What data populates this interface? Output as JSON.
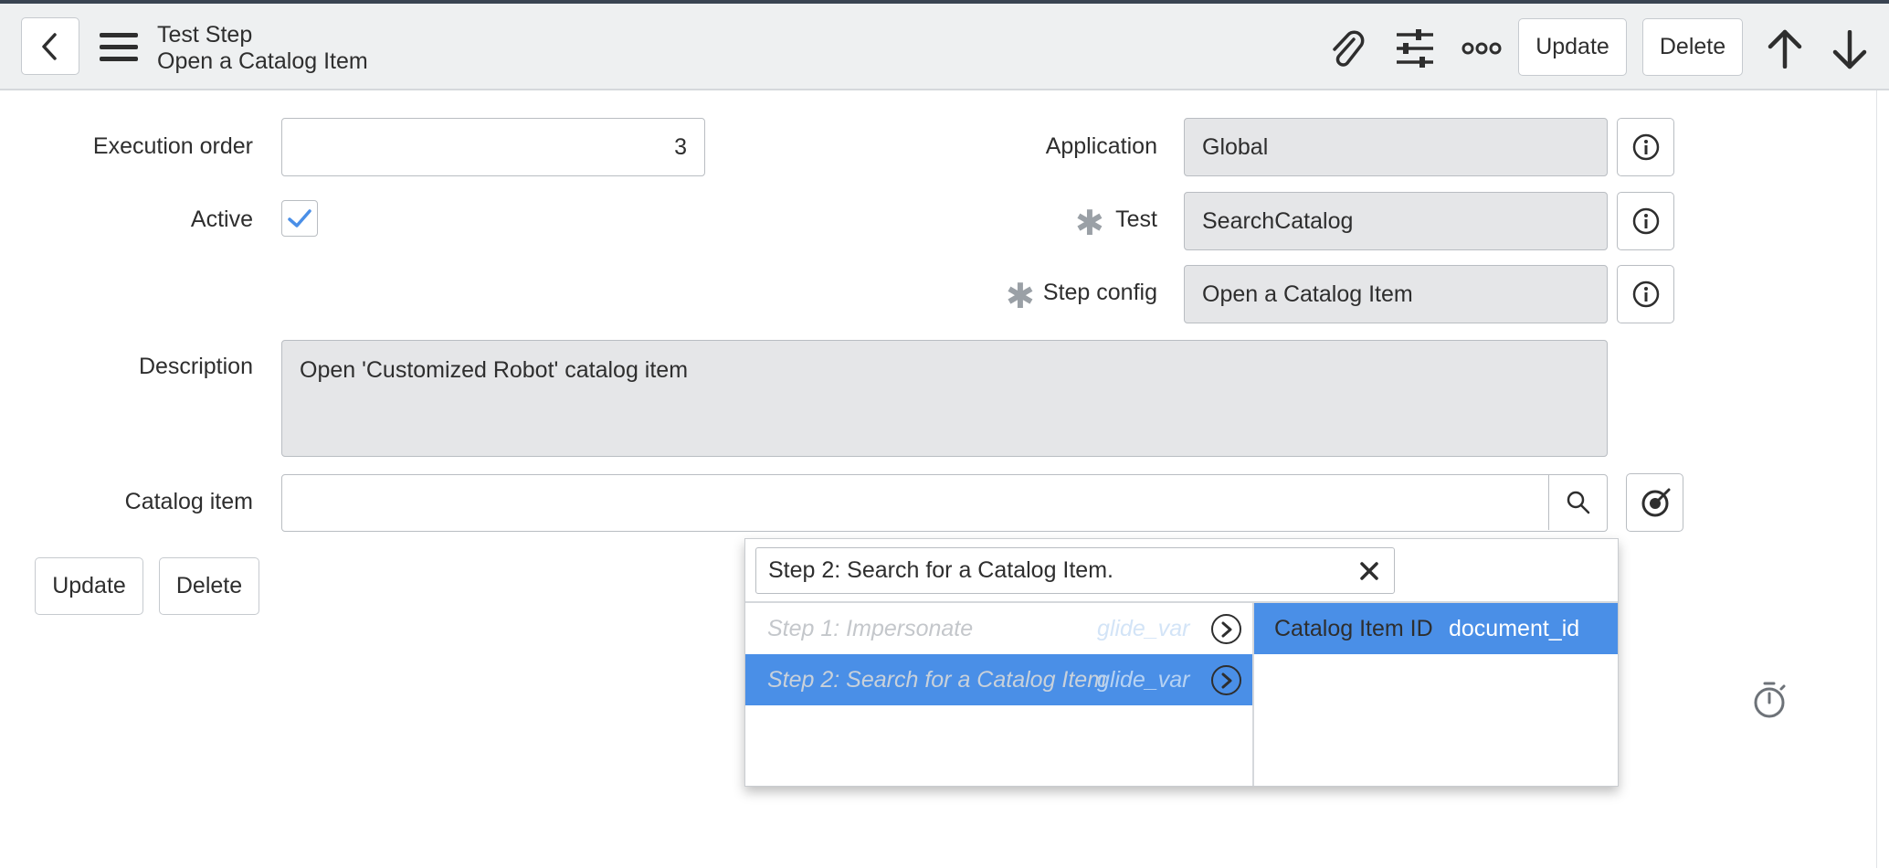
{
  "header": {
    "title": "Test Step",
    "subtitle": "Open a Catalog Item",
    "update_label": "Update",
    "delete_label": "Delete"
  },
  "form": {
    "execution_order": {
      "label": "Execution order",
      "value": "3"
    },
    "active": {
      "label": "Active",
      "checked": true
    },
    "application": {
      "label": "Application",
      "value": "Global"
    },
    "test": {
      "label": "Test",
      "value": "SearchCatalog"
    },
    "step_config": {
      "label": "Step config",
      "value": "Open a Catalog Item"
    },
    "description": {
      "label": "Description",
      "value": "Open 'Customized Robot' catalog item"
    },
    "catalog_item": {
      "label": "Catalog item",
      "value": ""
    }
  },
  "footer_buttons": {
    "update_label": "Update",
    "delete_label": "Delete"
  },
  "picker": {
    "filter_text": "Step 2: Search for a Catalog Item.",
    "steps": [
      {
        "name": "Step 1: Impersonate",
        "type": "glide_var",
        "selected": false
      },
      {
        "name": "Step 2: Search for a Catalog Item",
        "type": "glide_var",
        "selected": true
      }
    ],
    "outputs": [
      {
        "name": "Catalog Item ID",
        "type": "document_id",
        "selected": true
      }
    ]
  },
  "colors": {
    "accent": "#4a8fe7",
    "header_bg": "#eef0f1",
    "readonly_bg": "#e5e6e8"
  },
  "icons": [
    "back-icon",
    "menu-icon",
    "attachment-icon",
    "settings-icon",
    "more-icon",
    "arrow-up-icon",
    "arrow-down-icon",
    "info-icon",
    "search-icon",
    "dot-walk-icon",
    "timer-icon",
    "close-icon",
    "checkmark-icon",
    "chevron-right-icon"
  ]
}
